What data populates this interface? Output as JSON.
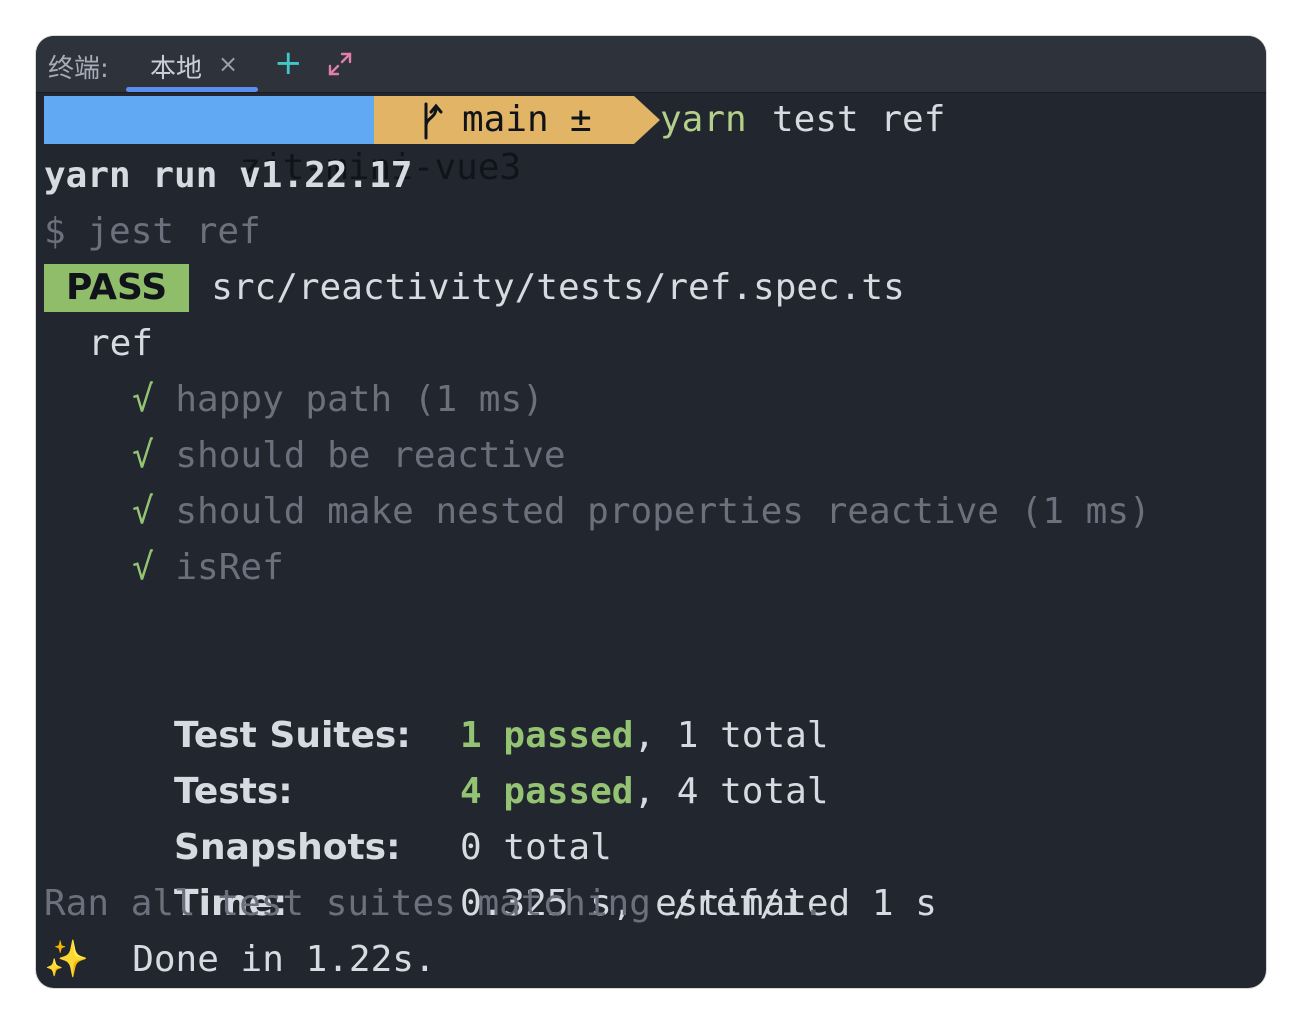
{
  "tabbar": {
    "label": "终端:",
    "tab_title": "本地",
    "close_glyph": "×",
    "add_glyph": "+",
    "expand_icon": "expand-icon"
  },
  "prompt": {
    "dir": "zjt-mini-vue3",
    "branch": "main",
    "dirty_flag": "±",
    "command_name": "yarn",
    "command_args": "test ref",
    "branch_icon": "git-branch-icon"
  },
  "output": {
    "yarn_header": "yarn run v1.22.17",
    "cmd_echo": "$ jest ref",
    "pass_badge": "PASS",
    "test_file": "src/reactivity/tests/ref.spec.ts",
    "suite_name": "ref",
    "check_glyph": "√",
    "tests": [
      {
        "name": "happy path (1 ms)"
      },
      {
        "name": "should be reactive"
      },
      {
        "name": "should make nested properties reactive (1 ms)"
      },
      {
        "name": "isRef"
      }
    ],
    "summary": {
      "suites_label": "Test Suites:",
      "suites_passed": "1 passed",
      "suites_total": ", 1 total",
      "tests_label": "Tests:",
      "tests_passed": "4 passed",
      "tests_total": ", 4 total",
      "snapshots_label": "Snapshots:",
      "snapshots_value": "0 total",
      "time_label": "Time:",
      "time_value": "0.325 s, estimated 1 s"
    },
    "ran_prefix": "Ran all test suites matching ",
    "ran_pattern": "/ref/i",
    "ran_suffix": ".",
    "done_icon": "✨",
    "done_text": "Done in 1.22s."
  },
  "colors": {
    "background": "#22262e",
    "dir_segment": "#61a9f2",
    "git_segment": "#e2b465",
    "pass_badge": "#8fbd6a",
    "green": "#94c473",
    "dim": "#6b717c"
  }
}
